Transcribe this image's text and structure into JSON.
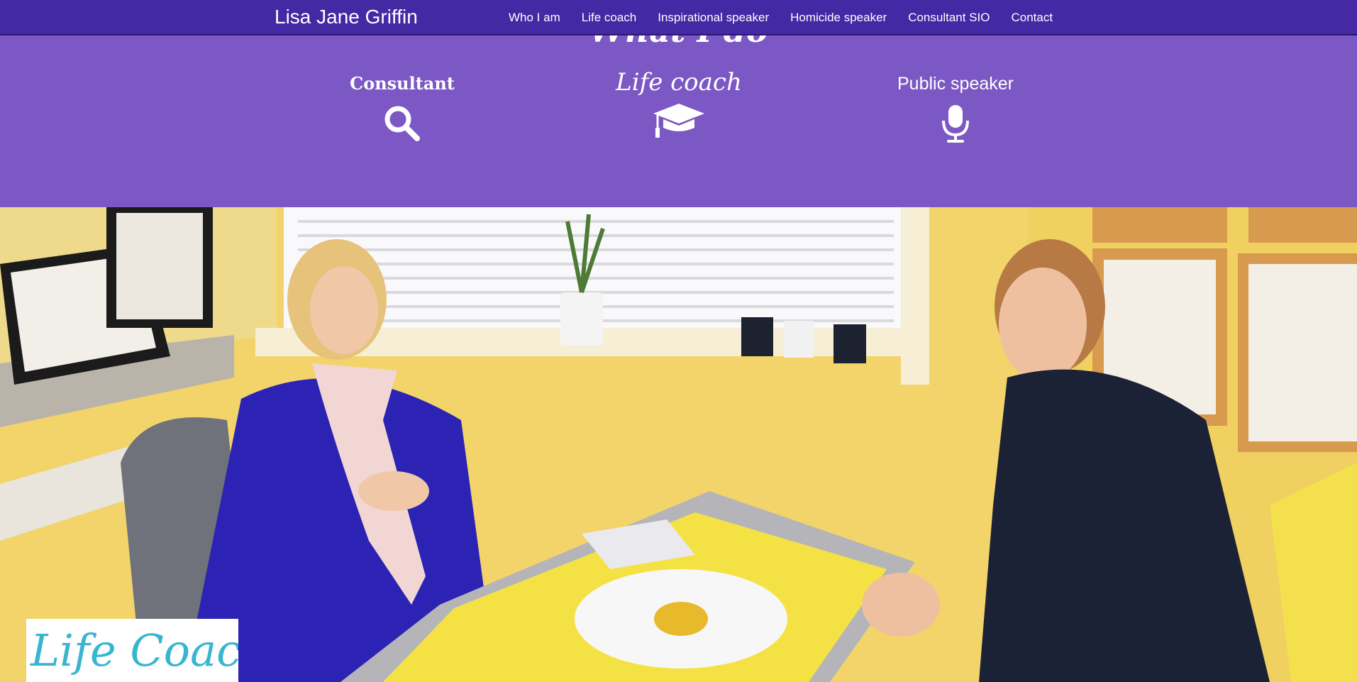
{
  "navbar": {
    "brand": "Lisa Jane Griffin",
    "items": [
      {
        "label": "Who I am"
      },
      {
        "label": "Life coach"
      },
      {
        "label": "Inspirational speaker"
      },
      {
        "label": "Homicide speaker"
      },
      {
        "label": "Consultant SIO"
      },
      {
        "label": "Contact"
      }
    ]
  },
  "services": {
    "title": "What I do",
    "items": [
      {
        "label": "Consultant",
        "icon": "search-icon"
      },
      {
        "label": "Life coach",
        "icon": "graduation-cap-icon"
      },
      {
        "label": "Public speaker",
        "icon": "microphone-icon"
      }
    ]
  },
  "hero": {
    "image": "lifecoach-session-photo",
    "badge": "Life Coach"
  },
  "colors": {
    "navbar": "#4428a4",
    "services_bg": "#7b58c4",
    "badge_text": "#38b6cf",
    "wall": "#f1d36b"
  }
}
